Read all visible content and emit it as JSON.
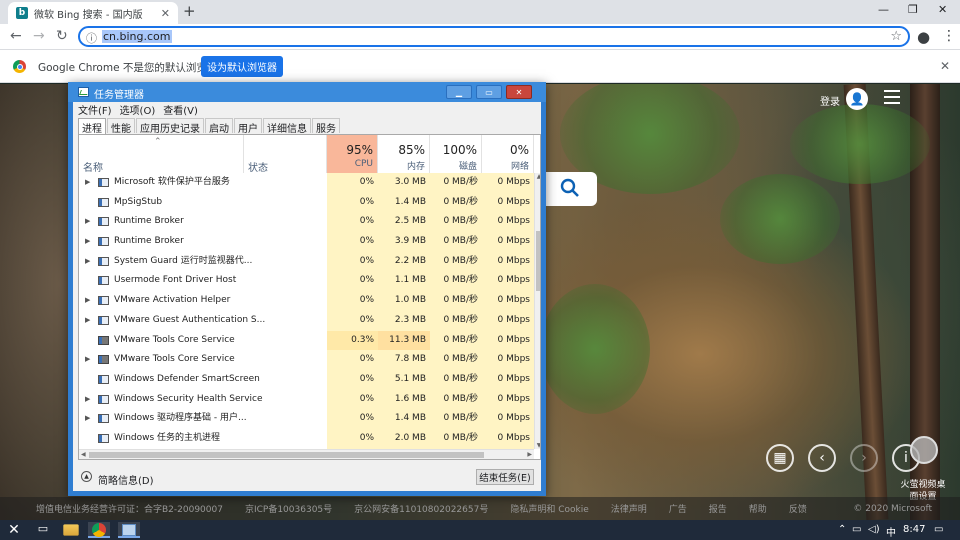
{
  "browser": {
    "tab_title": "微软 Bing 搜索 - 国内版",
    "tab_favicon": "bing-icon",
    "new_tab": "+",
    "window_controls": [
      "—",
      "❐",
      "✕"
    ],
    "url": "cn.bing.com",
    "infobar": {
      "message": "Google Chrome 不是您的默认浏览器",
      "button": "设为默认浏览器",
      "close": "✕"
    }
  },
  "bing": {
    "login": "登录",
    "promo": "火萤视频桌面设置",
    "footer": [
      "增值电信业务经营许可证：合字B2-20090007",
      "京ICP备10036305号",
      "京公网安备11010802022657号",
      "隐私声明和 Cookie",
      "法律声明",
      "广告",
      "报告",
      "帮助",
      "反馈"
    ],
    "copyright": "© 2020 Microsoft"
  },
  "taskmgr": {
    "title": "任务管理器",
    "menu": [
      "文件(F)",
      "选项(O)",
      "查看(V)"
    ],
    "tabs": [
      "进程",
      "性能",
      "应用历史记录",
      "启动",
      "用户",
      "详细信息",
      "服务"
    ],
    "columns": {
      "name": "名称",
      "status": "状态",
      "cpu": {
        "pct": "95%",
        "label": "CPU"
      },
      "mem": {
        "pct": "85%",
        "label": "内存"
      },
      "disk": {
        "pct": "100%",
        "label": "磁盘"
      },
      "net": {
        "pct": "0%",
        "label": "网络"
      }
    },
    "rows": [
      {
        "name": "Microsoft 软件保护平台服务",
        "cpu": "0%",
        "mem": "3.0 MB",
        "disk": "0 MB/秒",
        "net": "0 Mbps",
        "expand": true,
        "icon": "service-icon"
      },
      {
        "name": "MpSigStub",
        "cpu": "0%",
        "mem": "1.4 MB",
        "disk": "0 MB/秒",
        "net": "0 Mbps",
        "expand": false,
        "icon": "service-icon"
      },
      {
        "name": "Runtime Broker",
        "cpu": "0%",
        "mem": "2.5 MB",
        "disk": "0 MB/秒",
        "net": "0 Mbps",
        "expand": true,
        "icon": "service-icon"
      },
      {
        "name": "Runtime Broker",
        "cpu": "0%",
        "mem": "3.9 MB",
        "disk": "0 MB/秒",
        "net": "0 Mbps",
        "expand": true,
        "icon": "service-icon"
      },
      {
        "name": "System Guard 运行时监视器代...",
        "cpu": "0%",
        "mem": "2.2 MB",
        "disk": "0 MB/秒",
        "net": "0 Mbps",
        "expand": true,
        "icon": "service-icon"
      },
      {
        "name": "Usermode Font Driver Host",
        "cpu": "0%",
        "mem": "1.1 MB",
        "disk": "0 MB/秒",
        "net": "0 Mbps",
        "expand": false,
        "icon": "service-icon"
      },
      {
        "name": "VMware Activation Helper",
        "cpu": "0%",
        "mem": "1.0 MB",
        "disk": "0 MB/秒",
        "net": "0 Mbps",
        "expand": true,
        "icon": "service-icon"
      },
      {
        "name": "VMware Guest Authentication S...",
        "cpu": "0%",
        "mem": "2.3 MB",
        "disk": "0 MB/秒",
        "net": "0 Mbps",
        "expand": true,
        "icon": "service-icon"
      },
      {
        "name": "VMware Tools Core Service",
        "cpu": "0.3%",
        "mem": "11.3 MB",
        "disk": "0 MB/秒",
        "net": "0 Mbps",
        "expand": false,
        "icon": "vmware-icon",
        "hot": true
      },
      {
        "name": "VMware Tools Core Service",
        "cpu": "0%",
        "mem": "7.8 MB",
        "disk": "0 MB/秒",
        "net": "0 Mbps",
        "expand": true,
        "icon": "vmware-icon"
      },
      {
        "name": "Windows Defender SmartScreen",
        "cpu": "0%",
        "mem": "5.1 MB",
        "disk": "0 MB/秒",
        "net": "0 Mbps",
        "expand": false,
        "icon": "service-icon"
      },
      {
        "name": "Windows Security Health Service",
        "cpu": "0%",
        "mem": "1.6 MB",
        "disk": "0 MB/秒",
        "net": "0 Mbps",
        "expand": true,
        "icon": "service-icon"
      },
      {
        "name": "Windows 驱动程序基础 - 用户...",
        "cpu": "0%",
        "mem": "1.4 MB",
        "disk": "0 MB/秒",
        "net": "0 Mbps",
        "expand": true,
        "icon": "service-icon"
      },
      {
        "name": "Windows 任务的主机进程",
        "cpu": "0%",
        "mem": "2.0 MB",
        "disk": "0 MB/秒",
        "net": "0 Mbps",
        "expand": false,
        "icon": "service-icon"
      }
    ],
    "fewer_details": "简略信息(D)",
    "end_task": "结束任务(E)"
  },
  "taskbar": {
    "time": "8:47",
    "lang": "中"
  }
}
